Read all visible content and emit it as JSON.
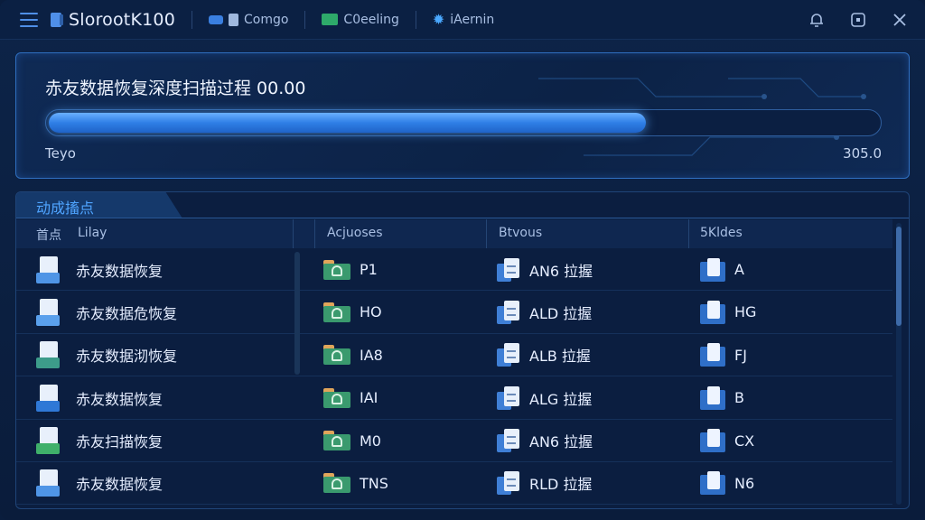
{
  "titlebar": {
    "app_title": "SlorootK100",
    "items": [
      {
        "label": "Comgo",
        "icon": "gamepad-icon",
        "color": "#3a7fe0"
      },
      {
        "label": "C0eeling",
        "icon": "chat-icon",
        "color": "#2eaa6a"
      },
      {
        "label": "iAernin",
        "icon": "gear-icon",
        "color": "#4aa8ff"
      }
    ],
    "controls": [
      "bell-icon",
      "stop-icon",
      "close-icon"
    ]
  },
  "progress": {
    "title": "赤友数据恢复深度扫描过程 00.00",
    "left_label": "Teyo",
    "right_label": "305.0",
    "fraction": 0.72
  },
  "table": {
    "tab_label": "动成搐点",
    "headers": [
      "首点",
      "Lilay",
      "Acjuoses",
      "Btvous",
      "5Kldes"
    ],
    "rows": [
      {
        "name": "赤友数据恢复",
        "c2": "P1",
        "c3": "AN6 拉握",
        "c4": "A",
        "file_color": "#4f95e6"
      },
      {
        "name": "赤友数据危恢复",
        "c2": "HO",
        "c3": "ALD 拉握",
        "c4": "HG",
        "file_color": "#5aa0ec"
      },
      {
        "name": "赤友数据沏恢复",
        "c2": "IA8",
        "c3": "ALB 拉握",
        "c4": "FJ",
        "file_color": "#3d9c8a"
      },
      {
        "name": "赤友数据恢复",
        "c2": "IAI",
        "c3": "ALG 拉握",
        "c4": "B",
        "file_color": "#2f78d6"
      },
      {
        "name": "赤友扫描恢复",
        "c2": "M0",
        "c3": "AN6 拉握",
        "c4": "CX",
        "file_color": "#3fb06a"
      },
      {
        "name": "赤友数据恢复",
        "c2": "TNS",
        "c3": "RLD 拉握",
        "c4": "N6",
        "file_color": "#4f95e6"
      }
    ]
  }
}
